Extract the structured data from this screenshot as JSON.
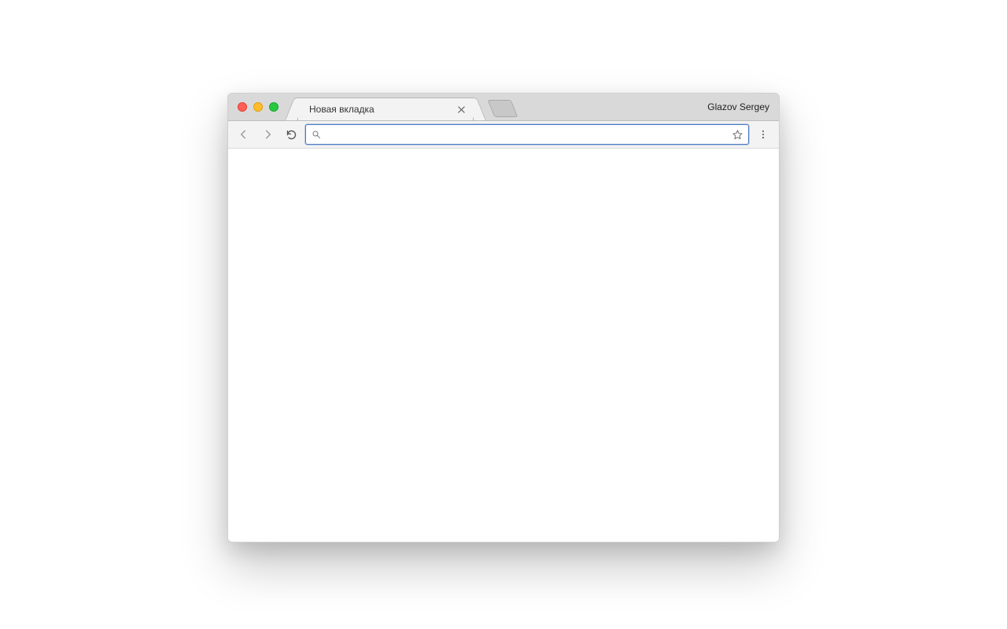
{
  "window": {
    "profile_name": "Glazov Sergey",
    "tabs": [
      {
        "label": "Новая вкладка"
      }
    ]
  },
  "toolbar": {
    "omnibox_value": "",
    "omnibox_placeholder": ""
  }
}
